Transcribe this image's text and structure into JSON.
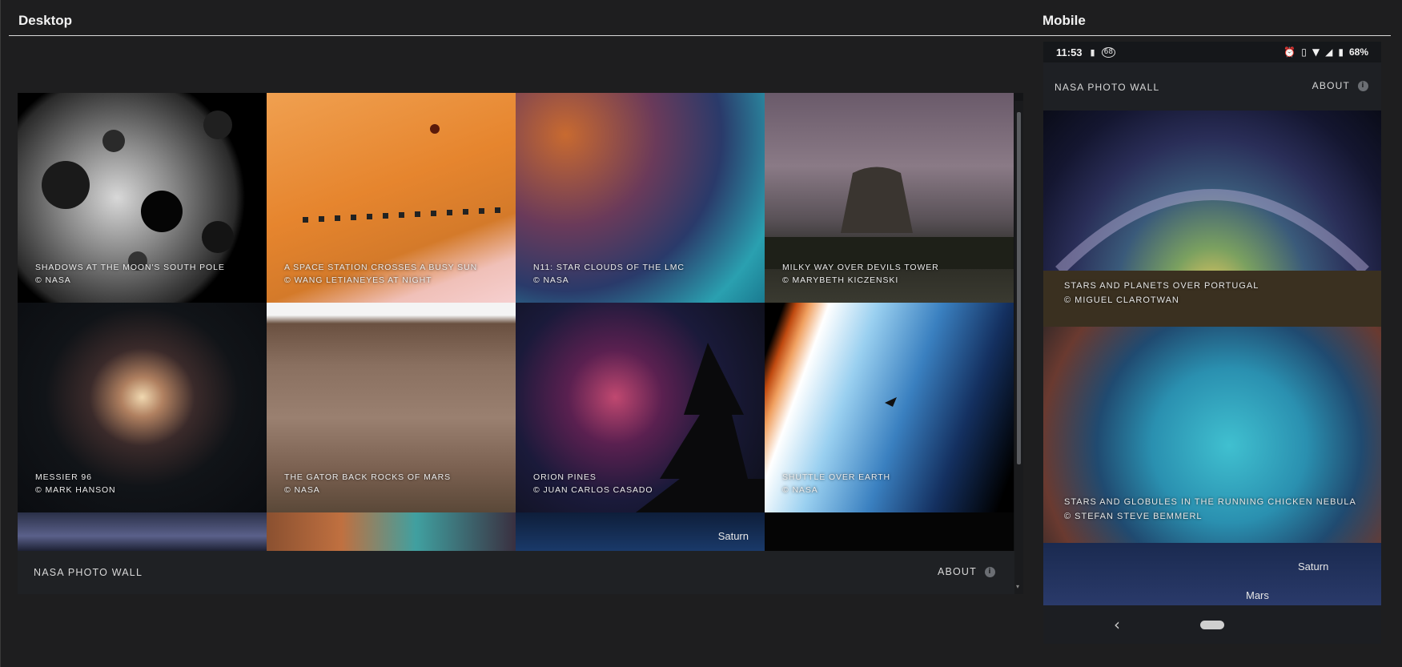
{
  "labels": {
    "desktop": "Desktop",
    "mobile": "Mobile"
  },
  "app": {
    "brand": "NASA PHOTO WALL",
    "about": "ABOUT",
    "info_glyph": "i"
  },
  "desktop": {
    "tiles": [
      {
        "title": "SHADOWS AT THE MOON'S SOUTH POLE",
        "credit": "© NASA"
      },
      {
        "title": "A SPACE STATION CROSSES A BUSY SUN",
        "credit": "© WANG LETIANEYES AT NIGHT"
      },
      {
        "title": "N11: STAR CLOUDS OF THE LMC",
        "credit": "© NASA"
      },
      {
        "title": "MILKY WAY OVER DEVILS TOWER",
        "credit": "© MARYBETH KICZENSKI"
      },
      {
        "title": "MESSIER 96",
        "credit": "© MARK HANSON"
      },
      {
        "title": "THE GATOR BACK ROCKS OF MARS",
        "credit": "© NASA"
      },
      {
        "title": "ORION PINES",
        "credit": "© JUAN CARLOS CASADO"
      },
      {
        "title": "SHUTTLE OVER EARTH",
        "credit": "© NASA"
      }
    ],
    "partial_label": "Saturn"
  },
  "mobile": {
    "status": {
      "time": "11:53",
      "notif_count": "68",
      "battery": "68%"
    },
    "tiles": [
      {
        "title": "STARS AND PLANETS OVER PORTUGAL",
        "credit": "© MIGUEL CLAROTWAN"
      },
      {
        "title": "STARS AND GLOBULES IN THE RUNNING CHICKEN NEBULA",
        "credit": "© STEFAN STEVE BEMMERL"
      }
    ],
    "partial_labels": [
      "Saturn",
      "Mars"
    ]
  },
  "icons": [
    "info-icon",
    "alarm-icon",
    "vibrate-icon",
    "wifi-icon",
    "signal-icon",
    "battery-icon",
    "back-icon",
    "home-icon"
  ]
}
